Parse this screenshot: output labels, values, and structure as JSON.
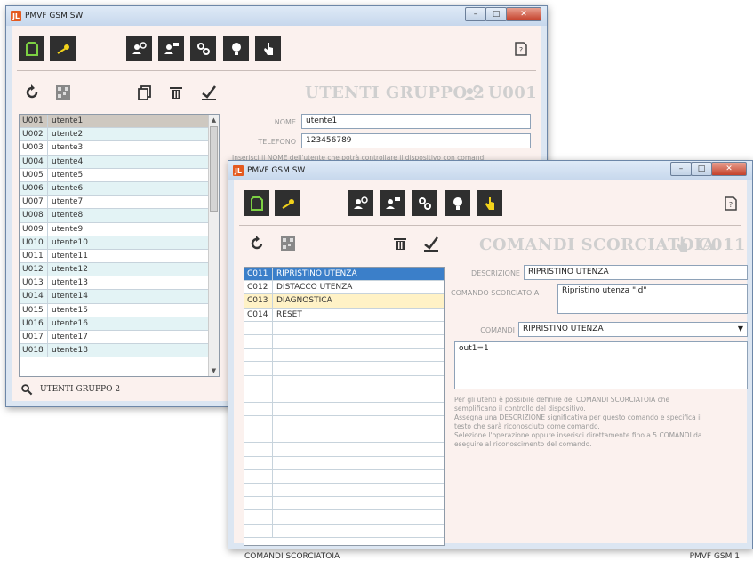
{
  "window1": {
    "title": "PMVF GSM SW",
    "app_icon_text": "JL",
    "header_title": "UTENTI GRUPPO 2",
    "header_code": "U001",
    "rows": [
      {
        "code": "U001",
        "name": "utente1"
      },
      {
        "code": "U002",
        "name": "utente2"
      },
      {
        "code": "U003",
        "name": "utente3"
      },
      {
        "code": "U004",
        "name": "utente4"
      },
      {
        "code": "U005",
        "name": "utente5"
      },
      {
        "code": "U006",
        "name": "utente6"
      },
      {
        "code": "U007",
        "name": "utente7"
      },
      {
        "code": "U008",
        "name": "utente8"
      },
      {
        "code": "U009",
        "name": "utente9"
      },
      {
        "code": "U010",
        "name": "utente10"
      },
      {
        "code": "U011",
        "name": "utente11"
      },
      {
        "code": "U012",
        "name": "utente12"
      },
      {
        "code": "U013",
        "name": "utente13"
      },
      {
        "code": "U014",
        "name": "utente14"
      },
      {
        "code": "U015",
        "name": "utente15"
      },
      {
        "code": "U016",
        "name": "utente16"
      },
      {
        "code": "U017",
        "name": "utente17"
      },
      {
        "code": "U018",
        "name": "utente18"
      }
    ],
    "nome_label": "NOME",
    "nome_value": "utente1",
    "telefono_label": "TELEFONO",
    "telefono_value": "123456789",
    "hint": "Inserisci il NOME dell'utente che potrà controllare il dispositivo con comandi",
    "footer": "UTENTI GRUPPO 2"
  },
  "window2": {
    "title": "PMVF GSM SW",
    "app_icon_text": "JL",
    "header_title": "COMANDI SCORCIATOIA",
    "header_code": "C011",
    "rows": [
      {
        "code": "C011",
        "name": "RIPRISTINO UTENZA"
      },
      {
        "code": "C012",
        "name": "DISTACCO UTENZA"
      },
      {
        "code": "C013",
        "name": "DIAGNOSTICA"
      },
      {
        "code": "C014",
        "name": "RESET"
      }
    ],
    "descrizione_label": "DESCRIZIONE",
    "descrizione_value": "RIPRISTINO UTENZA",
    "comando_label": "COMANDO SCORCIATOIA",
    "comando_value": "Ripristino utenza \"id\"",
    "comandi_label": "COMANDI",
    "comandi_value": "RIPRISTINO UTENZA",
    "commands_text": "out1=1",
    "hint_lines": [
      "Per gli utenti è possibile definire dei COMANDI SCORCIATOIA che",
      "semplificano il controllo del dispositivo.",
      "Assegna una DESCRIZIONE significativa per questo comando e specifica il",
      "testo che sarà riconosciuto come comando.",
      "Selezione l'operazione oppure inserisci direttamente fino a 5 COMANDI da",
      "eseguire al riconoscimento del comando."
    ],
    "footer_left": "COMANDI SCORCIATOIA",
    "footer_right": "PMVF GSM 1"
  },
  "colors": {
    "toolbar_button": "#2f2f2f",
    "icon_green": "#7dd043",
    "icon_yellow": "#f2d21b",
    "selection_blue": "#3b7fc9",
    "highlight_yellow": "#fff2c6",
    "client_bg": "#fbf1ee"
  },
  "icons": [
    "new-document-icon",
    "key-icon",
    "user-search-icon",
    "user-message-icon",
    "gears-icon",
    "lightbulb-icon",
    "hand-pointer-icon",
    "help-document-icon",
    "refresh-icon",
    "qr-code-icon",
    "copy-icon",
    "trash-icon",
    "checkmark-icon",
    "search-icon"
  ]
}
